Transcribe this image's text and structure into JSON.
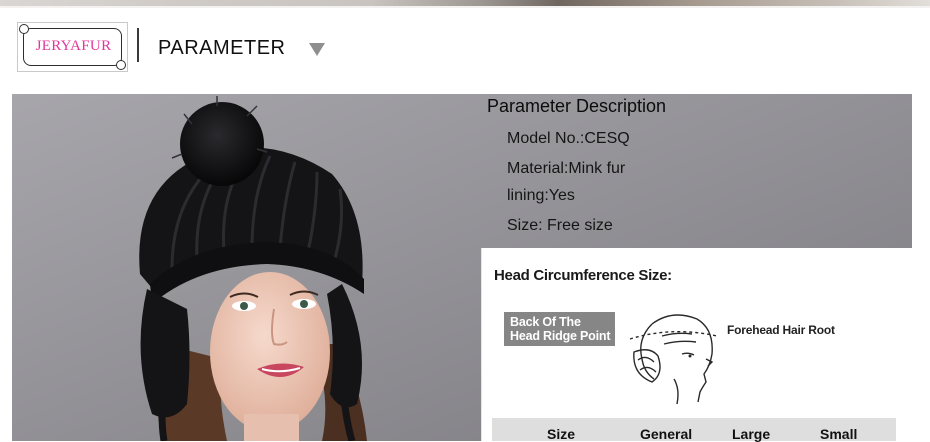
{
  "header": {
    "logo_text": "JERYAFUR",
    "title": "PARAMETER"
  },
  "icons": {
    "dropdown": "triangle-down-icon"
  },
  "parameter_description": {
    "title": "Parameter Description",
    "items": [
      "Model No.:CESQ",
      "Material:Mink fur",
      "lining:Yes",
      "Size: Free size"
    ]
  },
  "size_card": {
    "title": "Head Circumference Size:",
    "back_label_line1": "Back Of The",
    "back_label_line2": "Head Ridge Point",
    "forehead_label": "Forehead Hair Root",
    "columns": [
      "Size",
      "General",
      "Large",
      "Small"
    ]
  },
  "colors": {
    "logo_pink": "#e0389a",
    "photo_background": "#8c8b90",
    "hat_black": "#141416"
  }
}
